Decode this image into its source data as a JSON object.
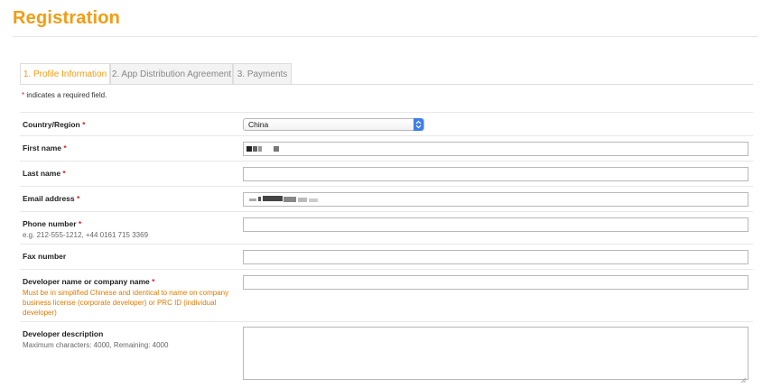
{
  "page": {
    "title": "Registration"
  },
  "tabs": [
    {
      "label": "1. Profile Information"
    },
    {
      "label": "2. App Distribution Agreement"
    },
    {
      "label": "3. Payments"
    }
  ],
  "required_note": {
    "star": "*",
    "text": " indicates a required field."
  },
  "form": {
    "country": {
      "label": "Country/Region",
      "star": "*",
      "value": "China"
    },
    "first_name": {
      "label": "First name",
      "star": "*"
    },
    "last_name": {
      "label": "Last name",
      "star": "*"
    },
    "email": {
      "label": "Email address",
      "star": "*"
    },
    "phone": {
      "label": "Phone number",
      "star": "*",
      "help": "e.g. 212-555-1212, +44 0161 715 3369"
    },
    "fax": {
      "label": "Fax number"
    },
    "developer_name": {
      "label": "Developer name or company name",
      "star": "*",
      "help_line1": "Must be in simplified Chinese and identical to name on company",
      "help_line2": "business license (corporate developer) or PRC ID (individual",
      "help_line3": "developer)"
    },
    "description": {
      "label": "Developer description",
      "help": "Maximum characters: 4000, Remaining: 4000"
    }
  },
  "colors": {
    "accent": "#f39c12",
    "required": "#e02020",
    "help_orange": "#e07a00",
    "select_button": "#3f7ee8"
  },
  "icons": {
    "select": "select-arrows-icon",
    "resize": "resize-grip-icon"
  }
}
